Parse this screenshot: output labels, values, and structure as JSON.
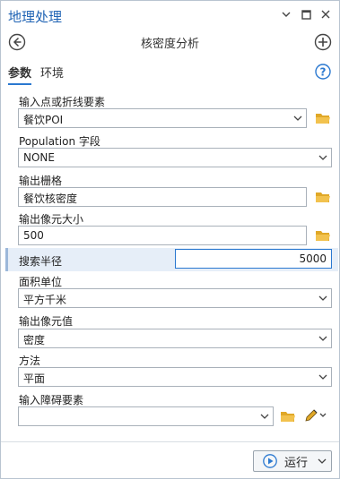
{
  "window": {
    "title": "地理处理"
  },
  "tool": {
    "title": "核密度分析"
  },
  "tabs": [
    {
      "label": "参数",
      "active": true
    },
    {
      "label": "环境",
      "active": false
    }
  ],
  "params": {
    "input_features": {
      "label": "输入点或折线要素",
      "value": "餐饮POI"
    },
    "population_field": {
      "label": "Population 字段",
      "value": "NONE"
    },
    "output_raster": {
      "label": "输出栅格",
      "value": "餐饮核密度"
    },
    "cell_size": {
      "label": "输出像元大小",
      "value": "500"
    },
    "search_radius": {
      "label": "搜索半径",
      "value": "5000"
    },
    "area_units": {
      "label": "面积单位",
      "value": "平方千米"
    },
    "output_values": {
      "label": "输出像元值",
      "value": "密度"
    },
    "method": {
      "label": "方法",
      "value": "平面"
    },
    "barriers": {
      "label": "输入障碍要素",
      "value": ""
    }
  },
  "run_button": {
    "label": "运行"
  },
  "colors": {
    "accent": "#1f63b4",
    "folder": "#e0a828",
    "run_icon": "#2a78d0"
  },
  "icons": [
    "chevron-down-icon",
    "restore-icon",
    "close-icon",
    "back-arrow-icon",
    "add-icon",
    "help-icon",
    "folder-icon",
    "pencil-icon",
    "play-icon"
  ]
}
